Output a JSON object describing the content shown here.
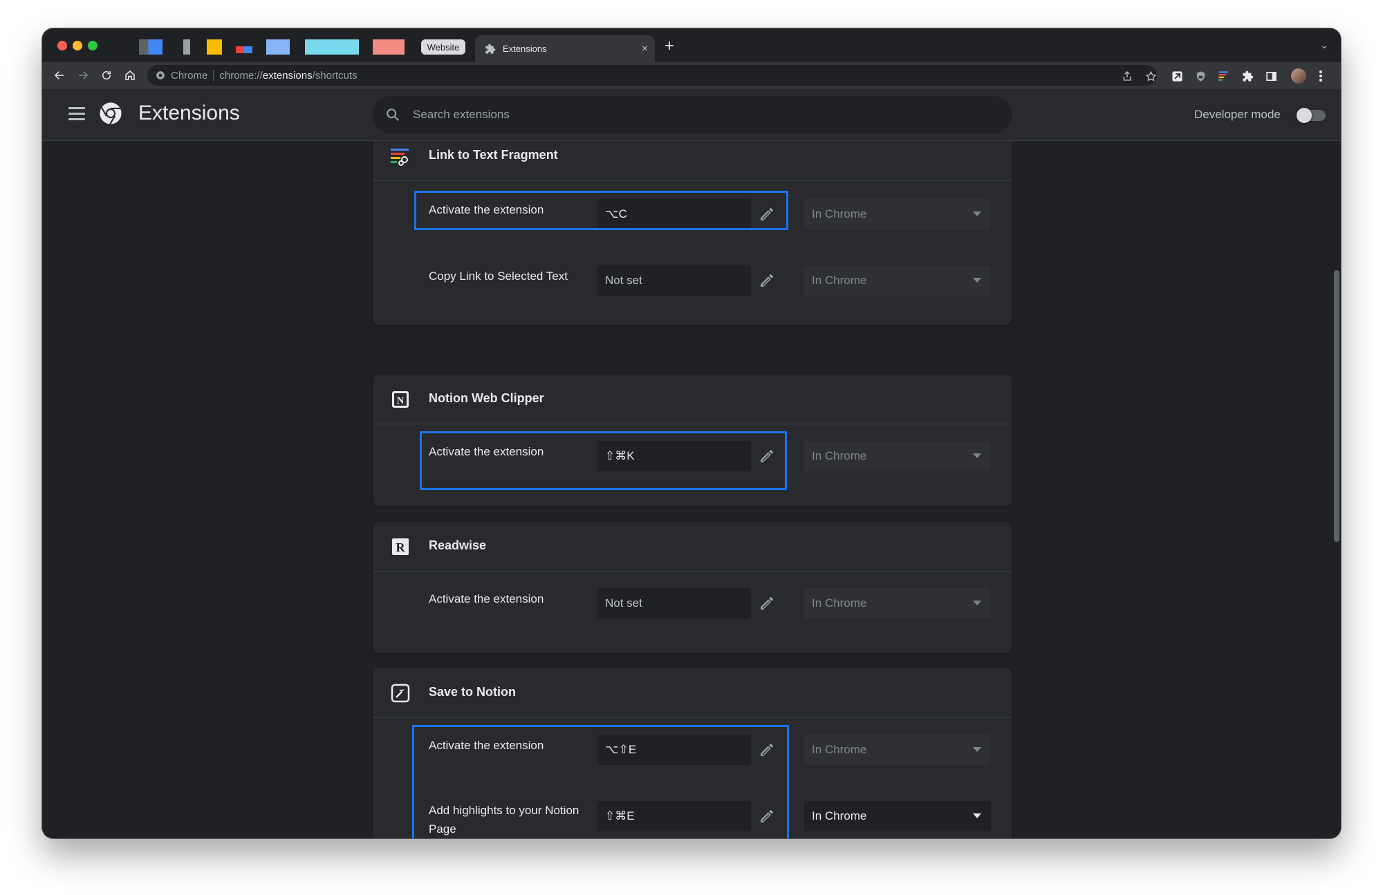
{
  "browser": {
    "pinned_tab_label": "Website",
    "active_tab_title": "Extensions",
    "new_tab_glyph": "+",
    "close_glyph": "×",
    "tab_search_glyph": "⌄",
    "omnibox": {
      "site_label": "Chrome",
      "url_scheme": "chrome://",
      "url_host": "extensions",
      "url_path": "/shortcuts"
    }
  },
  "header": {
    "title": "Extensions",
    "search_placeholder": "Search extensions",
    "developer_mode_label": "Developer mode",
    "developer_mode_on": false
  },
  "extensions": [
    {
      "name": "Link to Text Fragment",
      "icon": "link-fragment-icon",
      "shortcuts": [
        {
          "label": "Activate the extension",
          "value": "⌥C",
          "scope": "In Chrome",
          "scope_enabled": false
        },
        {
          "label": "Copy Link to Selected Text",
          "value": "Not set",
          "scope": "In Chrome",
          "scope_enabled": false
        }
      ]
    },
    {
      "name": "Notion Web Clipper",
      "icon": "notion-icon",
      "shortcuts": [
        {
          "label": "Activate the extension",
          "value": "⇧⌘K",
          "scope": "In Chrome",
          "scope_enabled": false
        }
      ]
    },
    {
      "name": "Readwise",
      "icon": "readwise-icon",
      "shortcuts": [
        {
          "label": "Activate the extension",
          "value": "Not set",
          "scope": "In Chrome",
          "scope_enabled": false
        }
      ]
    },
    {
      "name": "Save to Notion",
      "icon": "save-to-notion-icon",
      "shortcuts": [
        {
          "label": "Activate the extension",
          "value": "⌥⇧E",
          "scope": "In Chrome",
          "scope_enabled": false
        },
        {
          "label": "Add highlights to your Notion Page",
          "value": "⇧⌘E",
          "scope": "In Chrome",
          "scope_enabled": true
        }
      ]
    }
  ],
  "colors": {
    "highlight": "#1a73e8",
    "background": "#202124",
    "card": "#292a2d"
  }
}
